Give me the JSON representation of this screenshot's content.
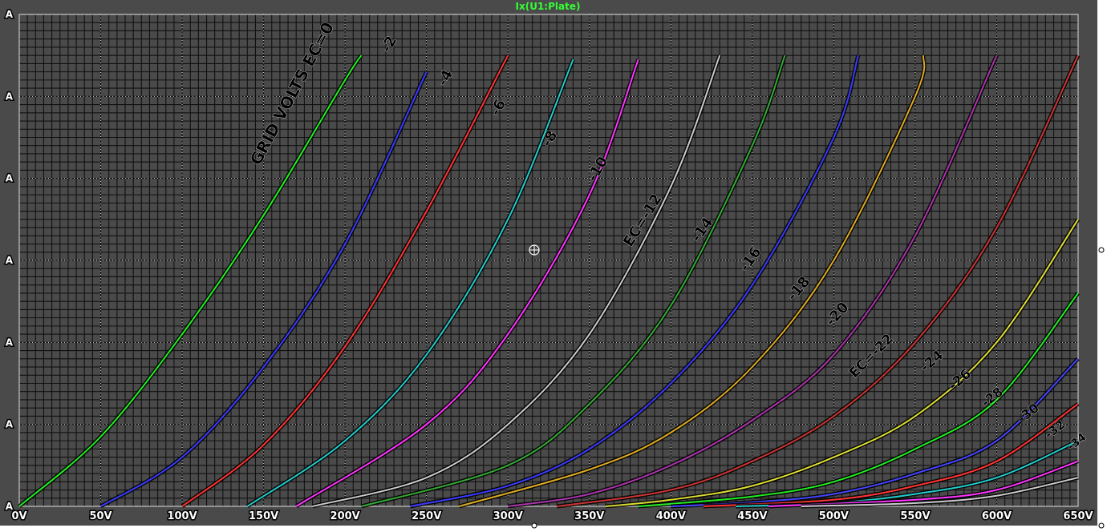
{
  "chart_data": {
    "type": "line",
    "title": "Ix(U1:Plate)",
    "xlabel": "",
    "ylabel": "",
    "xlim": [
      0,
      650
    ],
    "ylim": [
      0,
      60
    ],
    "x_ticks": [
      "0V",
      "50V",
      "100V",
      "150V",
      "200V",
      "250V",
      "300V",
      "350V",
      "400V",
      "450V",
      "500V",
      "550V",
      "600V",
      "650V"
    ],
    "y_ticks": [
      "A",
      "A",
      "A",
      "A",
      "A",
      "A",
      "A"
    ],
    "grid": true,
    "grid_annotation": "GRID VOLTS EC=0",
    "plot_bg": "#4a4a4a",
    "series": [
      {
        "label": "GRID VOLTS EC=0",
        "color": "#22ee22",
        "x": [
          0,
          50,
          100,
          150,
          200,
          210
        ],
        "y": [
          0,
          8.5,
          21,
          35.5,
          52,
          55
        ]
      },
      {
        "label": "-2",
        "color": "#3a3aff",
        "x": [
          50,
          100,
          150,
          200,
          250
        ],
        "y": [
          0,
          6,
          17,
          32,
          53
        ]
      },
      {
        "label": "-4",
        "color": "#ff3333",
        "x": [
          100,
          150,
          200,
          250,
          300
        ],
        "y": [
          0,
          7.5,
          19.5,
          36,
          55
        ]
      },
      {
        "label": "-6",
        "color": "#22cccc",
        "x": [
          140,
          200,
          250,
          300,
          340
        ],
        "y": [
          0,
          8,
          18.5,
          35,
          54.5
        ]
      },
      {
        "label": "-8",
        "color": "#ff33ff",
        "x": [
          170,
          250,
          300,
          350,
          380
        ],
        "y": [
          0,
          10,
          21,
          38,
          54.5
        ]
      },
      {
        "label": "-10",
        "color": "#cccccc",
        "x": [
          180,
          250,
          300,
          350,
          400,
          430
        ],
        "y": [
          0,
          3.5,
          10,
          21,
          39,
          55
        ]
      },
      {
        "label": "EC=-12",
        "color": "#33aa33",
        "x": [
          210,
          300,
          350,
          400,
          450,
          470
        ],
        "y": [
          0,
          5,
          12.5,
          24.5,
          44,
          55
        ]
      },
      {
        "label": "-14",
        "color": "#3a3aff",
        "x": [
          240,
          300,
          350,
          400,
          450,
          500,
          515
        ],
        "y": [
          0,
          2.5,
          7,
          15,
          27,
          45,
          55
        ]
      },
      {
        "label": "-16",
        "color": "#ddaa22",
        "x": [
          270,
          350,
          400,
          450,
          500,
          550,
          555
        ],
        "y": [
          0,
          4.5,
          9,
          17,
          30,
          50,
          55
        ]
      },
      {
        "label": "-18",
        "color": "#aa33aa",
        "x": [
          300,
          350,
          400,
          450,
          500,
          550,
          600
        ],
        "y": [
          0,
          1.5,
          5,
          10.5,
          18.5,
          33,
          55
        ]
      },
      {
        "label": "-20",
        "color": "#cc3333",
        "x": [
          330,
          400,
          450,
          500,
          550,
          600,
          650
        ],
        "y": [
          0,
          2,
          5.5,
          11,
          20,
          34,
          55
        ]
      },
      {
        "label": "EC=-22",
        "color": "#dddd33",
        "x": [
          360,
          400,
          450,
          500,
          550,
          600,
          650
        ],
        "y": [
          0,
          0.8,
          2.5,
          6,
          11,
          20,
          35
        ]
      },
      {
        "label": "-24",
        "color": "#22ee22",
        "x": [
          380,
          450,
          500,
          550,
          600,
          650
        ],
        "y": [
          0,
          1.2,
          3,
          7,
          13,
          26
        ]
      },
      {
        "label": "-26",
        "color": "#4444ff",
        "x": [
          400,
          450,
          500,
          550,
          600,
          650
        ],
        "y": [
          0,
          0.5,
          1.5,
          4,
          8,
          18
        ]
      },
      {
        "label": "-28",
        "color": "#ff3333",
        "x": [
          420,
          500,
          550,
          600,
          650
        ],
        "y": [
          0,
          0.8,
          2.5,
          5.5,
          12.5
        ]
      },
      {
        "label": "-30",
        "color": "#22cccc",
        "x": [
          440,
          500,
          550,
          600,
          650
        ],
        "y": [
          0,
          0.4,
          1.5,
          3.5,
          8
        ]
      },
      {
        "label": "-32",
        "color": "#ff33ff",
        "x": [
          460,
          550,
          600,
          650
        ],
        "y": [
          0,
          0.8,
          2,
          5.5
        ]
      },
      {
        "label": "-34",
        "color": "#cccccc",
        "x": [
          480,
          550,
          600,
          650
        ],
        "y": [
          0,
          0.4,
          1.3,
          3.5
        ]
      }
    ]
  }
}
